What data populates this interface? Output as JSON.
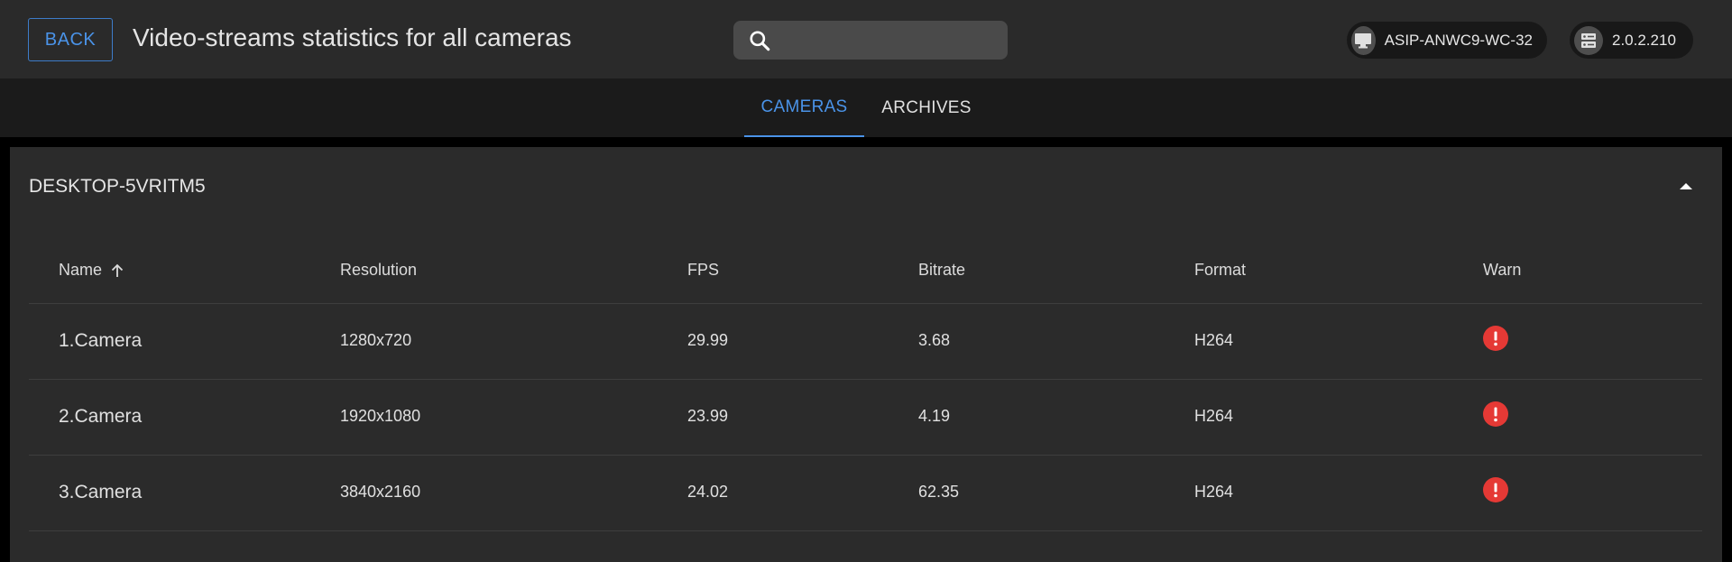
{
  "header": {
    "back_label": "BACK",
    "title": "Video-streams statistics for all cameras",
    "search": {
      "value": "",
      "placeholder": ""
    },
    "host_chip": {
      "label": "ASIP-ANWC9-WC-32",
      "icon": "monitor-icon"
    },
    "ip_chip": {
      "label": "2.0.2.210",
      "icon": "server-icon"
    }
  },
  "tabs": [
    {
      "label": "CAMERAS",
      "active": true
    },
    {
      "label": "ARCHIVES",
      "active": false
    }
  ],
  "panel": {
    "title": "DESKTOP-5VRITM5",
    "expanded": true,
    "columns": [
      "Name",
      "Resolution",
      "FPS",
      "Bitrate",
      "Format",
      "Warn"
    ],
    "sort": {
      "column": "Name",
      "direction": "ascending"
    },
    "rows": [
      {
        "name": "1.Camera",
        "resolution": "1280x720",
        "fps": "29.99",
        "bitrate": "3.68",
        "format": "H264",
        "warn": true
      },
      {
        "name": "2.Camera",
        "resolution": "1920x1080",
        "fps": "23.99",
        "bitrate": "4.19",
        "format": "H264",
        "warn": true
      },
      {
        "name": "3.Camera",
        "resolution": "3840x2160",
        "fps": "24.02",
        "bitrate": "62.35",
        "format": "H264",
        "warn": true
      }
    ]
  },
  "colors": {
    "accent": "#4a93e8",
    "warn": "#e53935",
    "header_bg": "#2a2a2a",
    "panel_bg": "#2b2b2b"
  }
}
